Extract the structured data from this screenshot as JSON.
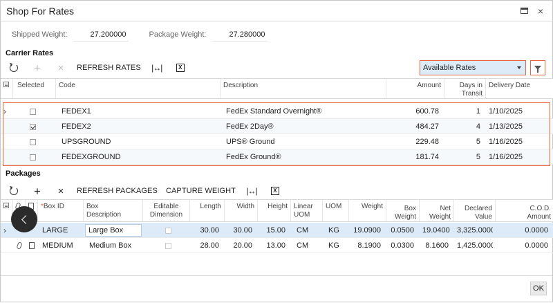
{
  "dialog": {
    "title": "Shop For Rates",
    "close": "×"
  },
  "weights": {
    "shipped_label": "Shipped Weight:",
    "shipped_value": "27.200000",
    "package_label": "Package Weight:",
    "package_value": "27.280000"
  },
  "carrier_rates": {
    "title": "Carrier Rates",
    "toolbar": {
      "refresh_label": "REFRESH RATES",
      "fit_glyph": "|↔|",
      "excel_glyph": "X"
    },
    "filter_select": {
      "value": "Available Rates"
    },
    "columns": {
      "selected": "Selected",
      "code": "Code",
      "description": "Description",
      "amount": "Amount",
      "days_line1": "Days in",
      "days_line2": "Transit",
      "delivery": "Delivery Date"
    },
    "rows": [
      {
        "selected": false,
        "code": "FEDEX1",
        "description": "FedEx Standard Overnight®",
        "amount": "600.78",
        "days": "1",
        "delivery": "1/10/2025"
      },
      {
        "selected": true,
        "code": "FEDEX2",
        "description": "FedEx 2Day®",
        "amount": "484.27",
        "days": "4",
        "delivery": "1/13/2025"
      },
      {
        "selected": false,
        "code": "UPSGROUND",
        "description": "UPS® Ground",
        "amount": "229.48",
        "days": "5",
        "delivery": "1/16/2025"
      },
      {
        "selected": false,
        "code": "FEDEXGROUND",
        "description": "FedEx Ground®",
        "amount": "181.74",
        "days": "5",
        "delivery": "1/16/2025"
      }
    ]
  },
  "packages": {
    "title": "Packages",
    "toolbar": {
      "refresh_label": "REFRESH PACKAGES",
      "capture_label": "CAPTURE WEIGHT",
      "fit_glyph": "|↔|",
      "excel_glyph": "X"
    },
    "columns": {
      "box_id": "Box ID",
      "box_desc_1": "Box",
      "box_desc_2": "Description",
      "editable_1": "Editable",
      "editable_2": "Dimension",
      "length": "Length",
      "width": "Width",
      "height": "Height",
      "linear_1": "Linear",
      "linear_2": "UOM",
      "uom": "UOM",
      "weight": "Weight",
      "box_weight_1": "Box",
      "box_weight_2": "Weight",
      "net_weight_1": "Net",
      "net_weight_2": "Weight",
      "declared_1": "Declared",
      "declared_2": "Value",
      "cod_1": "C.O.D.",
      "cod_2": "Amount",
      "required_mark": "*"
    },
    "rows": [
      {
        "box_id": "LARGE",
        "description": "Large Box",
        "length": "30.00",
        "width": "30.00",
        "height": "15.00",
        "linear_uom": "CM",
        "uom": "KG",
        "weight": "19.0900",
        "box_weight": "0.0500",
        "net_weight": "19.0400",
        "declared": "3,325.0000",
        "cod": "0.0000"
      },
      {
        "box_id": "MEDIUM",
        "description": "Medium Box",
        "length": "28.00",
        "width": "20.00",
        "height": "13.00",
        "linear_uom": "CM",
        "uom": "KG",
        "weight": "8.1900",
        "box_weight": "0.0300",
        "net_weight": "8.1600",
        "declared": "1,425.0000",
        "cod": "0.0000"
      }
    ]
  },
  "footer": {
    "ok_label": "OK"
  },
  "colors": {
    "accent_border": "#e8643c",
    "selection": "#dcebf7"
  }
}
